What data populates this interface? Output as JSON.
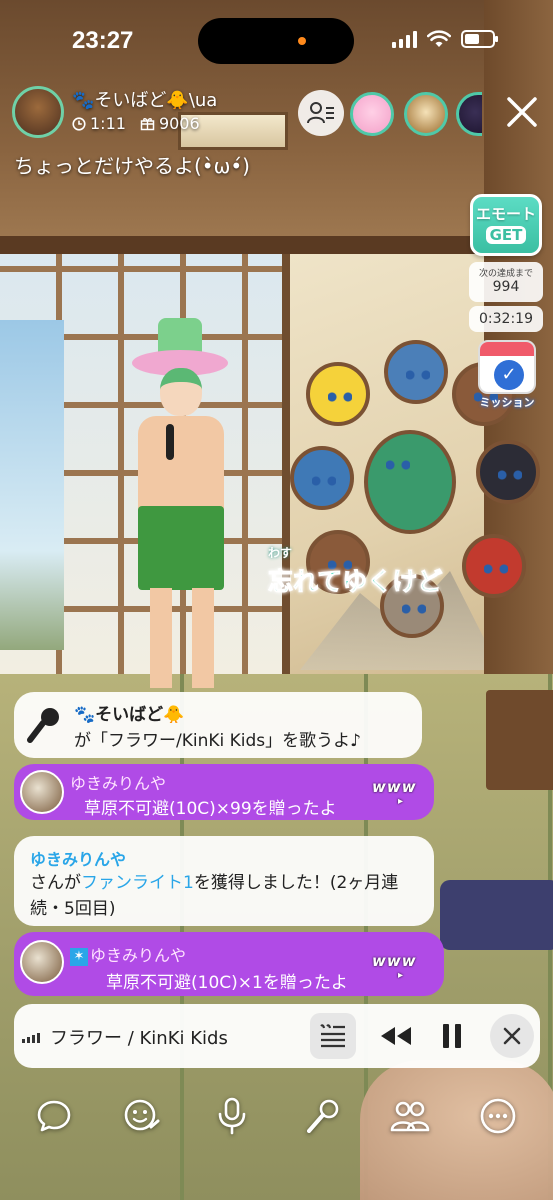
{
  "status_bar": {
    "time": "23:27",
    "battery_level": 0.55
  },
  "stream": {
    "host_name": "🐾そいばど🐥\\ua",
    "elapsed": "1:11",
    "gift_points": "9006",
    "title": "ちょっとだけやるよ(•̀ω•́)",
    "icons": {
      "viewers": "viewer-list-icon",
      "close": "close-icon",
      "clock": "clock-icon",
      "gift": "gift-icon"
    }
  },
  "side": {
    "emote_line1": "エモート",
    "emote_line2": "GET",
    "goal_label": "次の達成まで",
    "goal_value": "994",
    "timer": "0:32:19",
    "mission_label": "ミッション"
  },
  "lyrics": {
    "ruby": "わす",
    "line": "忘れてゆくけど"
  },
  "chat": {
    "song_request": {
      "user": "🐾そいばど🐥",
      "text": "が「フラワー/KinKi Kids」を歌うよ♪"
    },
    "gift1": {
      "user": "ゆきみりんや",
      "text": "草原不可避(10C)×99を贈ったよ",
      "stamp": "www"
    },
    "fan_light": {
      "user": "ゆきみりんや",
      "prefix": "さんが",
      "link": "ファンライト1",
      "suffix": "を獲得しました！(2ヶ月連続・5回目)"
    },
    "gift2": {
      "user": "ゆきみりんや",
      "text": "草原不可避(10C)×1を贈ったよ",
      "stamp": "www"
    }
  },
  "now_playing": {
    "title": "フラワー / KinKi Kids"
  },
  "toolbar": {
    "items": [
      "comment-icon",
      "emoji-icon",
      "microphone-icon",
      "karaoke-mic-icon",
      "collab-users-icon",
      "more-icon"
    ]
  }
}
